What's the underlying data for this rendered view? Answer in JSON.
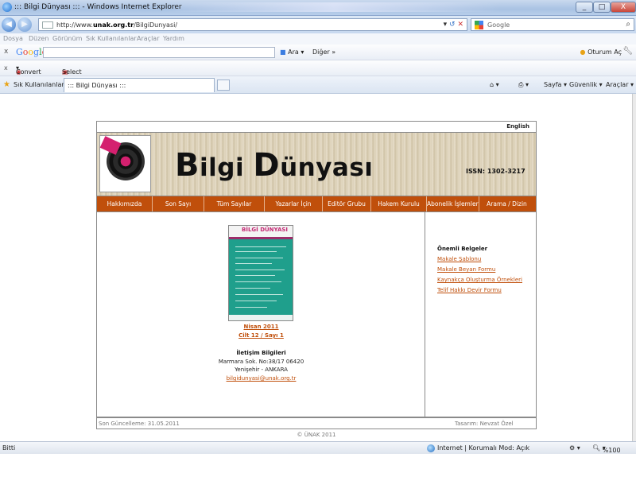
{
  "browser": {
    "window_title": "::: Bilgi Dünyası ::: - Windows Internet Explorer",
    "address_url_prefix": "http://www.",
    "address_url_domain": "unak.org.tr",
    "address_url_path": "/BilgiDunyasi/",
    "search_placeholder": "Google",
    "menu": [
      "Dosya",
      "Düzen",
      "Görünüm",
      "Sık Kullanılanlar",
      "Araçlar",
      "Yardım"
    ],
    "google_toolbar": {
      "close": "x",
      "logo": "Google",
      "search_button": "Ara",
      "more_button": "Diğer »",
      "signin": "Oturum Aç"
    },
    "convert_toolbar": {
      "close": "x",
      "convert": "Convert",
      "select": "Select"
    },
    "favorites_bar": {
      "label": "Sık Kullanılanlar",
      "tab_title": "::: Bilgi Dünyası :::",
      "page_menu": "Sayfa",
      "safety_menu": "Güvenlik",
      "tools_menu": "Araçlar"
    },
    "status": {
      "left": "Bitti",
      "zone": "Internet | Korumalı Mod: Açık",
      "zoom": "%100"
    }
  },
  "site": {
    "language_link": "English",
    "brand_first": "B",
    "brand_rest1": "ilgi ",
    "brand_second": "D",
    "brand_rest2": "ünyası",
    "issn": "ISSN: 1302-3217",
    "nav": [
      "Hakkımızda",
      "Son Sayı",
      "Tüm Sayılar",
      "Yazarlar İçin",
      "Editör Grubu",
      "Hakem Kurulu",
      "Abonelik İşlemleri",
      "Arama / Dizin"
    ],
    "cover_title": "BİLGİ DÜNYASI",
    "issue_date": "Nisan 2011",
    "issue_volume": "Cilt 12 / Sayı 1",
    "contact": {
      "heading": "İletişim Bilgileri",
      "address1": "Marmara Sok. No:38/17 06420",
      "address2": "Yenişehir - ANKARA",
      "email": "bilgidunyasi@unak.org.tr"
    },
    "documents": {
      "heading": "Önemli Belgeler",
      "links": [
        "Makale Şablonu",
        "Makale Beyan Formu",
        "Kaynakça Oluşturma Örnekleri",
        "Telif Hakkı Devir Formu"
      ]
    },
    "footer": {
      "last_update": "Son Güncelleme: 31.05.2011",
      "design": "Tasarım: Nevzat Özel",
      "copyright": "© ÜNAK 2011"
    }
  },
  "colors": {
    "nav_orange": "#c04f0b",
    "cover_teal": "#1f9f8c",
    "accent_magenta": "#d4206f"
  }
}
